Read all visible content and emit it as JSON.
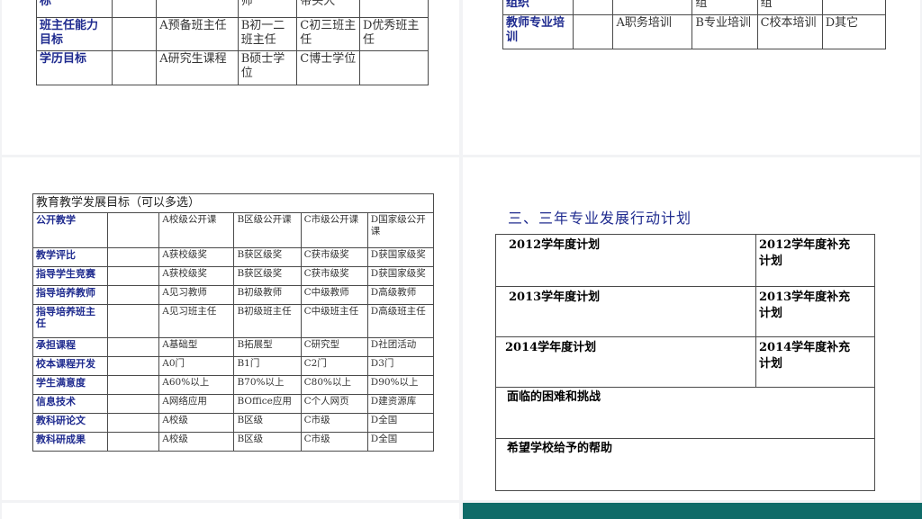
{
  "top_left_table": {
    "rows": [
      {
        "label": "标",
        "cells": [
          "",
          "",
          "师",
          "带头人",
          ""
        ]
      },
      {
        "label": "班主任能力目标",
        "cells": [
          "",
          "A预备班主任",
          "B初一二班主任",
          "C初三班主任",
          "D优秀班主任"
        ]
      },
      {
        "label": "学历目标",
        "cells": [
          "",
          "A研究生课程",
          "B硕士学位",
          "C博士学位",
          ""
        ]
      }
    ]
  },
  "top_right_table": {
    "rows": [
      {
        "label": "组织",
        "cells": [
          "",
          "",
          "组",
          "组",
          ""
        ]
      },
      {
        "label": "教师专业培训",
        "cells": [
          "",
          "A职务培训",
          "B专业培训",
          "C校本培训",
          "D其它"
        ]
      }
    ]
  },
  "goals_table": {
    "title": "教育教学发展目标（可以多选）",
    "rows": [
      {
        "label": "公开教学",
        "cells": [
          "",
          "A校级公开课",
          "B区级公开课",
          "C市级公开课",
          "D国家级公开课"
        ]
      },
      {
        "label": "教学评比",
        "cells": [
          "",
          "A获校级奖",
          "B获区级奖",
          "C获市级奖",
          "D获国家级奖"
        ]
      },
      {
        "label": "指导学生竞赛",
        "cells": [
          "",
          "A获校级奖",
          "B获区级奖",
          "C获市级奖",
          "D获国家级奖"
        ]
      },
      {
        "label": "指导培养教师",
        "cells": [
          "",
          "A见习教师",
          "B初级教师",
          "C中级教师",
          "D高级教师"
        ]
      },
      {
        "label": "指导培养班主任",
        "cells": [
          "",
          "A见习班主任",
          "B初级班主任",
          "C中级班主任",
          "D高级班主任"
        ]
      },
      {
        "label": "承担课程",
        "cells": [
          "",
          "A基础型",
          "B拓展型",
          "C研究型",
          "D社团活动"
        ]
      },
      {
        "label": "校本课程开发",
        "cells": [
          "",
          "A0门",
          "B1门",
          "C2门",
          "D3门"
        ]
      },
      {
        "label": "学生满意度",
        "cells": [
          "",
          "A60%以上",
          "B70%以上",
          "C80%以上",
          "D90%以上"
        ]
      },
      {
        "label": "信息技术",
        "cells": [
          "",
          "A网络应用",
          "BOffice应用",
          "C个人网页",
          "D建资源库"
        ]
      },
      {
        "label": "教科研论文",
        "cells": [
          "",
          "A校级",
          "B区级",
          "C市级",
          "D全国"
        ]
      },
      {
        "label": "教科研成果",
        "cells": [
          "",
          "A校级",
          "B区级",
          "C市级",
          "D全国"
        ]
      }
    ]
  },
  "plan_section": {
    "heading": "三、三年专业发展行动计划",
    "years": [
      {
        "plan": "2012学年度计划",
        "supplement": "2012学年度补充计划"
      },
      {
        "plan": "2013学年度计划",
        "supplement": "2013学年度补充计划"
      },
      {
        "plan": "2014学年度计划",
        "supplement": "2014学年度补充计划"
      }
    ],
    "difficulties": "面临的困难和挑战",
    "help": "希望学校给予的帮助"
  }
}
